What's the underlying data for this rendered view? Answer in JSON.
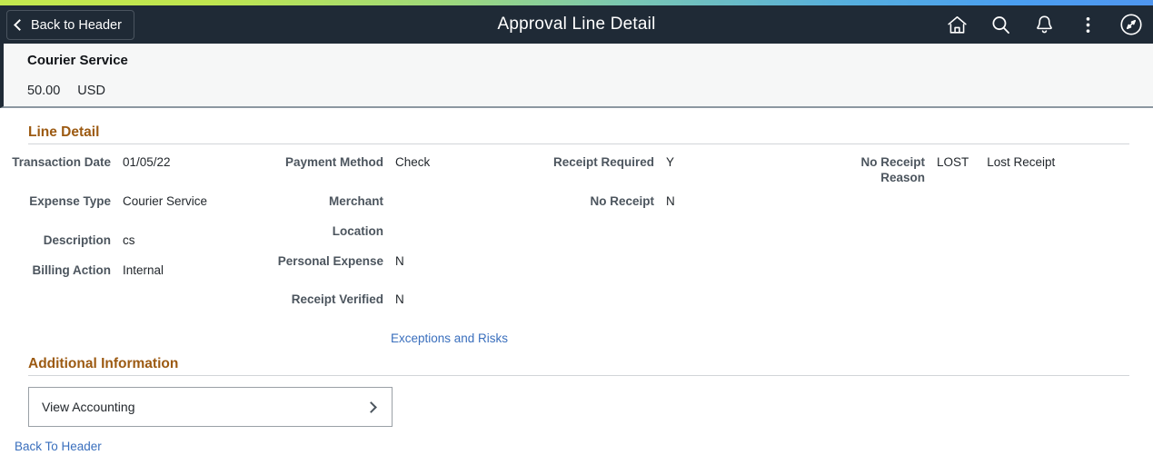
{
  "window": {
    "title": "Approval Line Detail"
  },
  "header": {
    "back_label": "Back to Header",
    "title": "Approval Line Detail",
    "icons": [
      {
        "name": "home-icon",
        "label": "Home"
      },
      {
        "name": "search-icon",
        "label": "Search"
      },
      {
        "name": "notifications-bell-icon",
        "label": "Notifications"
      },
      {
        "name": "actions-menu-icon",
        "label": "Actions"
      },
      {
        "name": "navbar-compass-icon",
        "label": "NavBar"
      }
    ]
  },
  "summary": {
    "expense_title": "Courier Service",
    "amount": "50.00",
    "currency": "USD"
  },
  "line_detail": {
    "section_title": "Line Detail",
    "fields": {
      "transaction_date": {
        "label": "Transaction Date",
        "value": "01/05/22"
      },
      "expense_type": {
        "label": "Expense Type",
        "value": "Courier Service"
      },
      "description": {
        "label": "Description",
        "value": "cs"
      },
      "billing_action": {
        "label": "Billing Action",
        "value": "Internal"
      },
      "payment_method": {
        "label": "Payment Method",
        "value": "Check"
      },
      "merchant": {
        "label": "Merchant",
        "value": ""
      },
      "location": {
        "label": "Location",
        "value": ""
      },
      "personal_expense": {
        "label": "Personal Expense",
        "value": "N"
      },
      "receipt_verified": {
        "label": "Receipt Verified",
        "value": "N"
      },
      "receipt_required": {
        "label": "Receipt Required",
        "value": "Y"
      },
      "no_receipt": {
        "label": "No Receipt",
        "value": "N"
      },
      "no_receipt_reason": {
        "label": "No Receipt Reason",
        "value": "LOST",
        "description": "Lost Receipt"
      }
    },
    "exceptions_link": "Exceptions and Risks"
  },
  "additional_information": {
    "section_title": "Additional Information",
    "view_accounting_label": "View Accounting"
  },
  "footer": {
    "back_to_header_link": "Back To Header"
  },
  "colors": {
    "header_bg": "#1f2a36",
    "section_heading": "#9c5a12",
    "link": "#3a6fbd",
    "label": "#4c555e",
    "accent_gradient_start": "#c2e84f",
    "accent_gradient_end": "#4f96ef"
  }
}
